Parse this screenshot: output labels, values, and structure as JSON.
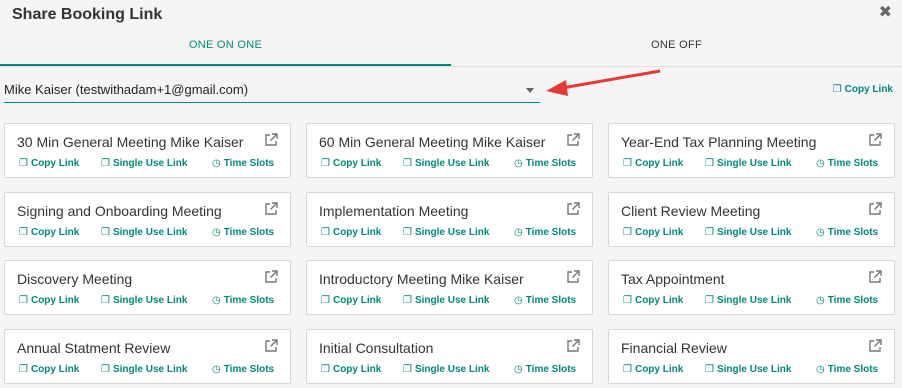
{
  "header": {
    "title": "Share Booking Link",
    "close_glyph": "✖"
  },
  "tabs": [
    {
      "label": "ONE ON ONE",
      "active": true
    },
    {
      "label": "ONE OFF",
      "active": false
    }
  ],
  "selector": {
    "value": "Mike Kaiser (testwithadam+1@gmail.com)"
  },
  "top_copy_label": "Copy Link",
  "link_labels": {
    "copy": "Copy Link",
    "single": "Single Use Link",
    "slots": "Time Slots"
  },
  "icons": {
    "copy": "copy-icon",
    "single": "link-icon",
    "slots": "clock-icon",
    "external": "external-link-icon"
  },
  "colors": {
    "accent": "#00897b",
    "arrow": "#e53935"
  },
  "meetings": [
    "30 Min General Meeting Mike Kaiser",
    "60 Min General Meeting Mike Kaiser",
    "Year-End Tax Planning Meeting",
    "Signing and Onboarding Meeting",
    "Implementation Meeting",
    "Client Review Meeting",
    "Discovery Meeting",
    "Introductory Meeting Mike Kaiser",
    "Tax Appointment",
    "Annual Statment Review",
    "Initial Consultation",
    "Financial Review"
  ]
}
